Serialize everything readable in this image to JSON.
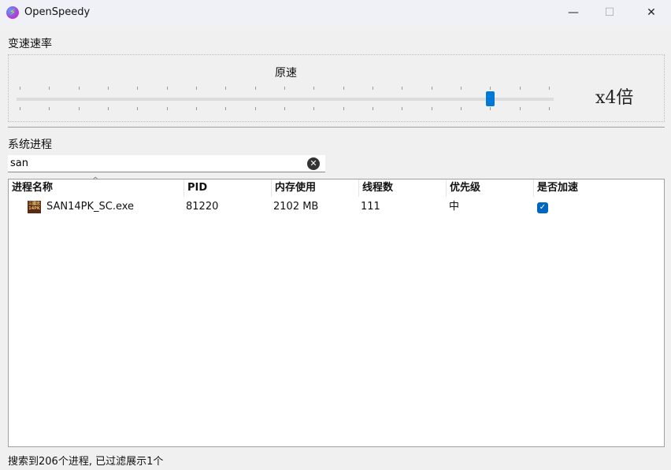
{
  "window": {
    "title": "OpenSpeedy",
    "minimize": "—",
    "maximize": "☐",
    "close": "✕"
  },
  "speed": {
    "section_label": "变速速率",
    "caption": "原速",
    "multiplier": "x4倍",
    "slider_fraction": 0.889,
    "tick_count": 19
  },
  "process": {
    "section_label": "系统进程",
    "search_value": "san",
    "clear_icon": "✕"
  },
  "table": {
    "columns": [
      "进程名称",
      "PID",
      "内存使用",
      "线程数",
      "优先级",
      "是否加速"
    ],
    "rows": [
      {
        "name": "SAN14PK_SC.exe",
        "icon_text": "三國志14PK",
        "pid": "81220",
        "memory": "2102 MB",
        "threads": "111",
        "priority": "中",
        "accelerated": true
      }
    ]
  },
  "status": "搜索到206个进程, 已过滤展示1个",
  "colors": {
    "accent": "#0078d7",
    "checkbox": "#0067c0"
  }
}
